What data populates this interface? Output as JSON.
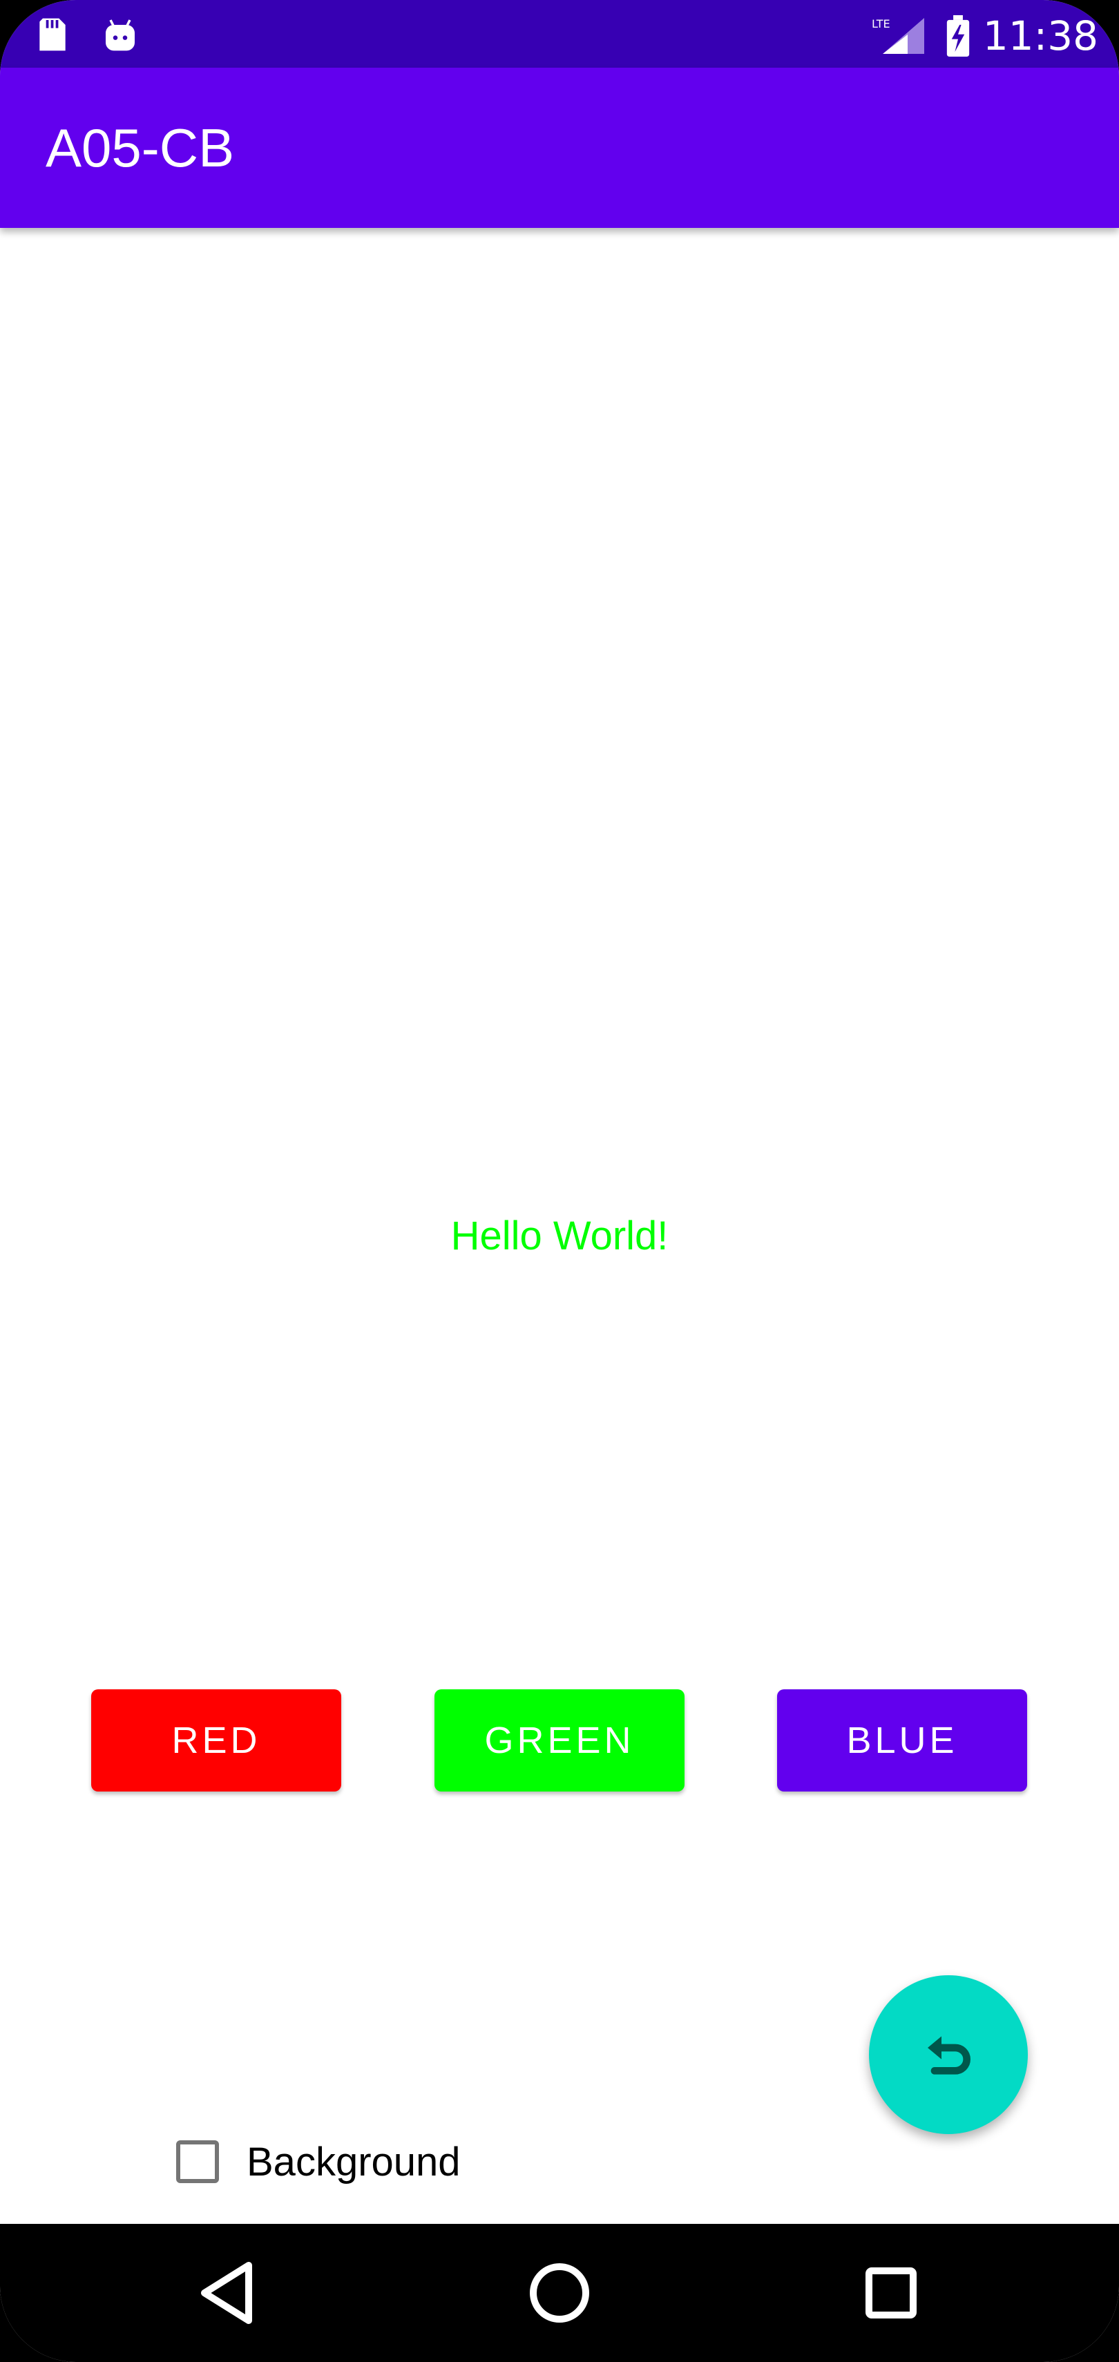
{
  "status_bar": {
    "time": "11:38",
    "icons": [
      "sd-card-icon",
      "android-icon",
      "lte-signal-icon",
      "battery-charging-icon"
    ],
    "network_label": "LTE"
  },
  "app_bar": {
    "title": "A05-CB"
  },
  "main": {
    "hello_text": "Hello World!",
    "hello_color": "#00ff00",
    "buttons": [
      {
        "label": "RED",
        "color": "#ff0000"
      },
      {
        "label": "GREEN",
        "color": "#00ff00"
      },
      {
        "label": "BLUE",
        "color": "#6200ee"
      }
    ],
    "fab": {
      "icon": "undo-icon",
      "color": "#03dac5"
    },
    "checkbox": {
      "label": "Background",
      "checked": false
    }
  },
  "nav_bar": {
    "icons": [
      "back-icon",
      "home-icon",
      "recents-icon"
    ]
  },
  "colors": {
    "status_bar": "#3700b3",
    "app_bar": "#6200ee",
    "accent": "#03dac5"
  }
}
